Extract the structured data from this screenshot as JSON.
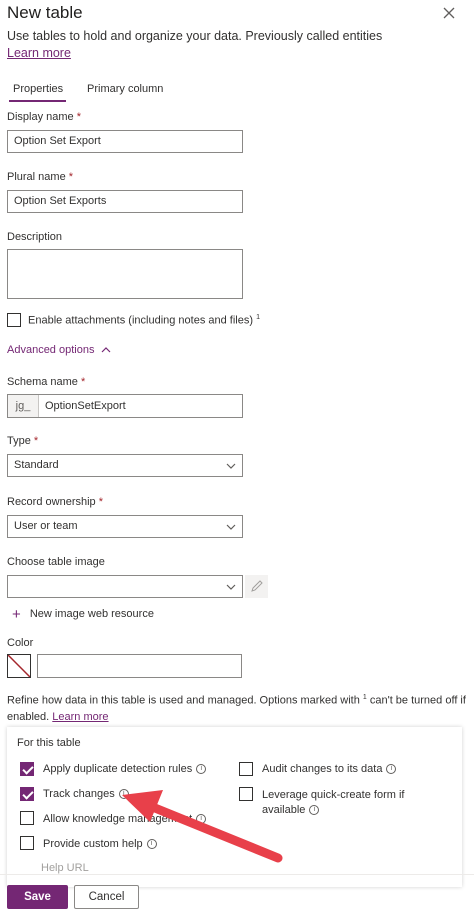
{
  "header": {
    "title": "New table",
    "subtitle": "Use tables to hold and organize your data. Previously called entities",
    "learn_more": "Learn more"
  },
  "tabs": [
    {
      "label": "Properties",
      "selected": true
    },
    {
      "label": "Primary column",
      "selected": false
    }
  ],
  "form": {
    "display_name": {
      "label": "Display name",
      "required": "*",
      "value": "Option Set Export"
    },
    "plural_name": {
      "label": "Plural name",
      "required": "*",
      "value": "Option Set Exports"
    },
    "description": {
      "label": "Description",
      "value": ""
    },
    "enable_attachments": {
      "label": "Enable attachments (including notes and files)",
      "footnote": "1",
      "checked": false
    },
    "advanced_options": {
      "label": "Advanced options",
      "expanded": true
    },
    "schema_name": {
      "label": "Schema name",
      "required": "*",
      "prefix": "jg_",
      "value": "OptionSetExport"
    },
    "type": {
      "label": "Type",
      "required": "*",
      "value": "Standard"
    },
    "record_ownership": {
      "label": "Record ownership",
      "required": "*",
      "value": "User or team"
    },
    "table_image": {
      "label": "Choose table image",
      "value": "",
      "new_resource": "New image web resource"
    },
    "color": {
      "label": "Color",
      "value": ""
    },
    "refine_text": "Refine how data in this table is used and managed. Options marked with",
    "refine_footnote": "1",
    "refine_text_2": "can't be turned off if enabled.",
    "refine_learn_more": "Learn more"
  },
  "for_this_table": {
    "heading": "For this table",
    "left": [
      {
        "label": "Apply duplicate detection rules",
        "checked": true
      },
      {
        "label": "Track changes",
        "checked": true
      },
      {
        "label": "Allow knowledge management",
        "checked": false
      },
      {
        "label": "Provide custom help",
        "checked": false
      }
    ],
    "right": [
      {
        "label": "Audit changes to its data",
        "checked": false
      },
      {
        "label": "Leverage quick-create form if",
        "label2": "available",
        "checked": false
      }
    ],
    "help_url": "Help URL"
  },
  "footer": {
    "save": "Save",
    "cancel": "Cancel"
  },
  "colors": {
    "accent": "#742774",
    "required": "#a4262c",
    "arrow": "#e8404a"
  }
}
